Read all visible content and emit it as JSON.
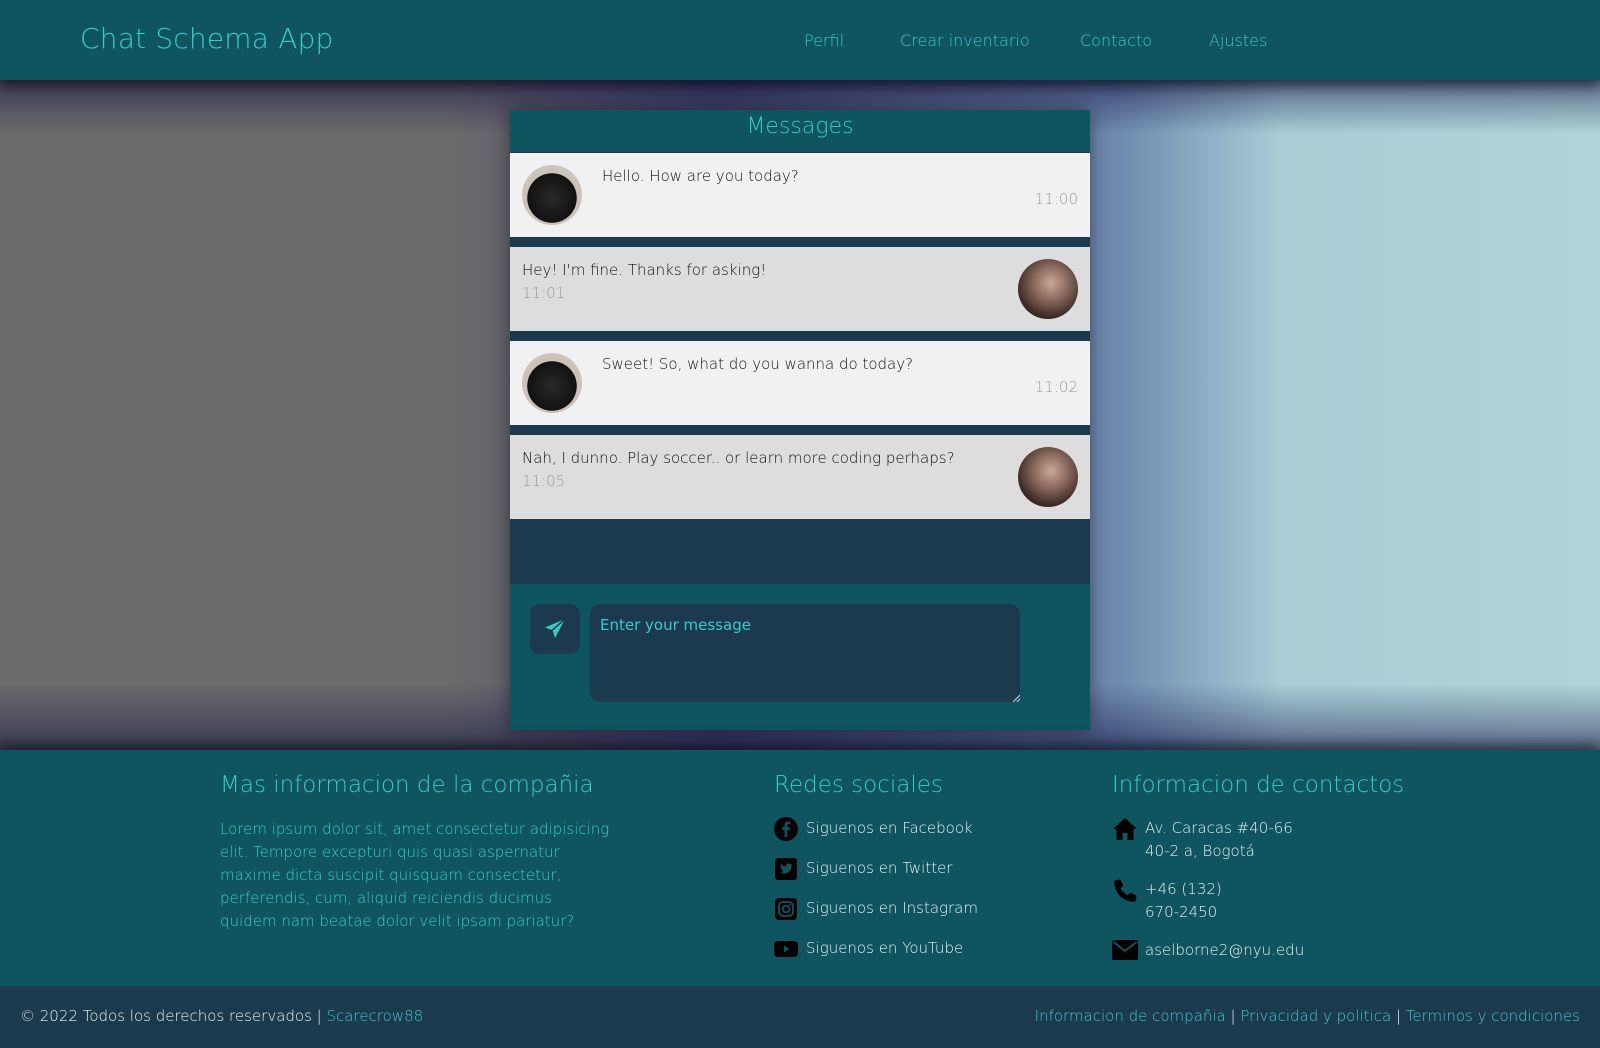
{
  "header": {
    "brand": "Chat Schema App",
    "nav": [
      {
        "label": "Perfil"
      },
      {
        "label": "Crear inventario"
      },
      {
        "label": "Contacto"
      },
      {
        "label": "Ajustes"
      }
    ]
  },
  "chat": {
    "title": "Messages",
    "messages": [
      {
        "text": "Hello. How are you today?",
        "time": "11:00",
        "direction": "in"
      },
      {
        "text": "Hey! I'm fine. Thanks for asking!",
        "time": "11:01",
        "direction": "out"
      },
      {
        "text": "Sweet! So, what do you wanna do today?",
        "time": "11:02",
        "direction": "in"
      },
      {
        "text": "Nah, I dunno. Play soccer.. or learn more coding perhaps?",
        "time": "11:05",
        "direction": "out"
      }
    ],
    "composer": {
      "placeholder": "Enter your message",
      "send_icon": "paper-plane-icon"
    }
  },
  "footer": {
    "about": {
      "heading": "Mas informacion de la compañia",
      "text": "Lorem ipsum dolor sit, amet consectetur adipisicing elit. Tempore excepturi quis quasi aspernatur maxime dicta suscipit quisquam consectetur, perferendis, cum, aliquid reiciendis ducimus quidem nam beatae dolor velit ipsam pariatur?"
    },
    "social": {
      "heading": "Redes sociales",
      "items": [
        {
          "label": "Siguenos en Facebook",
          "icon": "facebook-icon"
        },
        {
          "label": "Siguenos en Twitter",
          "icon": "twitter-icon"
        },
        {
          "label": "Siguenos en Instagram",
          "icon": "instagram-icon"
        },
        {
          "label": "Siguenos en YouTube",
          "icon": "youtube-icon"
        }
      ]
    },
    "contact": {
      "heading": "Informacion de contactos",
      "address": [
        "Av. Caracas #40-66",
        "40-2 a, Bogotá"
      ],
      "phone": [
        "+46 (132)",
        "670-2450"
      ],
      "email": "aselborne2@nyu.edu"
    }
  },
  "bottom": {
    "copyright": "© 2022 Todos los derechos reservados |",
    "author": "Scarecrow88",
    "links": [
      "Informacion de compañia",
      "Privacidad y politica",
      "Terminos y condiciones"
    ],
    "separator": "|"
  },
  "colors": {
    "primary": "#0e5560",
    "dark": "#1c3a4e",
    "accent": "#3ccbc9",
    "incoming_bg": "#f1f1f1",
    "outgoing_bg": "#dddddd"
  }
}
